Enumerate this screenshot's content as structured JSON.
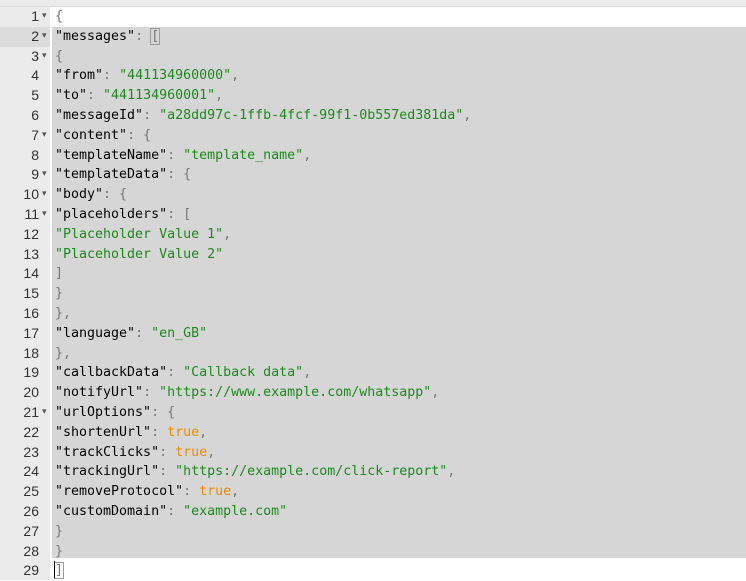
{
  "editor": {
    "active_line": 2,
    "fold_icon": "chevron-down-icon",
    "lines": [
      {
        "n": "1",
        "fold": true,
        "tokens": [
          {
            "t": "{",
            "c": "p"
          }
        ]
      },
      {
        "n": "2",
        "fold": true,
        "tokens": [
          {
            "t": "\"messages\"",
            "c": "k"
          },
          {
            "t": ": ",
            "c": "p"
          },
          {
            "t": "[",
            "c": "bm"
          }
        ]
      },
      {
        "n": "3",
        "fold": true,
        "tokens": [
          {
            "t": "{",
            "c": "p"
          }
        ]
      },
      {
        "n": "4",
        "fold": false,
        "tokens": [
          {
            "t": "\"from\"",
            "c": "k"
          },
          {
            "t": ": ",
            "c": "p"
          },
          {
            "t": "\"441134960000\"",
            "c": "s"
          },
          {
            "t": ",",
            "c": "p"
          }
        ]
      },
      {
        "n": "5",
        "fold": false,
        "tokens": [
          {
            "t": "\"to\"",
            "c": "k"
          },
          {
            "t": ": ",
            "c": "p"
          },
          {
            "t": "\"441134960001\"",
            "c": "s"
          },
          {
            "t": ",",
            "c": "p"
          }
        ]
      },
      {
        "n": "6",
        "fold": false,
        "tokens": [
          {
            "t": "\"messageId\"",
            "c": "k"
          },
          {
            "t": ": ",
            "c": "p"
          },
          {
            "t": "\"a28dd97c-1ffb-4fcf-99f1-0b557ed381da\"",
            "c": "s"
          },
          {
            "t": ",",
            "c": "p"
          }
        ]
      },
      {
        "n": "7",
        "fold": true,
        "tokens": [
          {
            "t": "\"content\"",
            "c": "k"
          },
          {
            "t": ": {",
            "c": "p"
          }
        ]
      },
      {
        "n": "8",
        "fold": false,
        "tokens": [
          {
            "t": "\"templateName\"",
            "c": "k"
          },
          {
            "t": ": ",
            "c": "p"
          },
          {
            "t": "\"template_name\"",
            "c": "s"
          },
          {
            "t": ",",
            "c": "p"
          }
        ]
      },
      {
        "n": "9",
        "fold": true,
        "tokens": [
          {
            "t": "\"templateData\"",
            "c": "k"
          },
          {
            "t": ": {",
            "c": "p"
          }
        ]
      },
      {
        "n": "10",
        "fold": true,
        "tokens": [
          {
            "t": "\"body\"",
            "c": "k"
          },
          {
            "t": ": {",
            "c": "p"
          }
        ]
      },
      {
        "n": "11",
        "fold": true,
        "tokens": [
          {
            "t": "\"placeholders\"",
            "c": "k"
          },
          {
            "t": ": [",
            "c": "p"
          }
        ]
      },
      {
        "n": "12",
        "fold": false,
        "tokens": [
          {
            "t": "\"Placeholder Value 1\"",
            "c": "s"
          },
          {
            "t": ",",
            "c": "p"
          }
        ]
      },
      {
        "n": "13",
        "fold": false,
        "tokens": [
          {
            "t": "\"Placeholder Value 2\"",
            "c": "s"
          }
        ]
      },
      {
        "n": "14",
        "fold": false,
        "tokens": [
          {
            "t": "]",
            "c": "p"
          }
        ]
      },
      {
        "n": "15",
        "fold": false,
        "tokens": [
          {
            "t": "}",
            "c": "p"
          }
        ]
      },
      {
        "n": "16",
        "fold": false,
        "tokens": [
          {
            "t": "},",
            "c": "p"
          }
        ]
      },
      {
        "n": "17",
        "fold": false,
        "tokens": [
          {
            "t": "\"language\"",
            "c": "k"
          },
          {
            "t": ": ",
            "c": "p"
          },
          {
            "t": "\"en_GB\"",
            "c": "s"
          }
        ]
      },
      {
        "n": "18",
        "fold": false,
        "tokens": [
          {
            "t": "},",
            "c": "p"
          }
        ]
      },
      {
        "n": "19",
        "fold": false,
        "tokens": [
          {
            "t": "\"callbackData\"",
            "c": "k"
          },
          {
            "t": ": ",
            "c": "p"
          },
          {
            "t": "\"Callback data\"",
            "c": "s"
          },
          {
            "t": ",",
            "c": "p"
          }
        ]
      },
      {
        "n": "20",
        "fold": false,
        "tokens": [
          {
            "t": "\"notifyUrl\"",
            "c": "k"
          },
          {
            "t": ": ",
            "c": "p"
          },
          {
            "t": "\"https://www.example.com/whatsapp\"",
            "c": "s"
          },
          {
            "t": ",",
            "c": "p"
          }
        ]
      },
      {
        "n": "21",
        "fold": true,
        "tokens": [
          {
            "t": "\"urlOptions\"",
            "c": "k"
          },
          {
            "t": ": {",
            "c": "p"
          }
        ]
      },
      {
        "n": "22",
        "fold": false,
        "tokens": [
          {
            "t": "\"shortenUrl\"",
            "c": "k"
          },
          {
            "t": ": ",
            "c": "p"
          },
          {
            "t": "true",
            "c": "b"
          },
          {
            "t": ",",
            "c": "p"
          }
        ]
      },
      {
        "n": "23",
        "fold": false,
        "tokens": [
          {
            "t": "\"trackClicks\"",
            "c": "k"
          },
          {
            "t": ": ",
            "c": "p"
          },
          {
            "t": "true",
            "c": "b"
          },
          {
            "t": ",",
            "c": "p"
          }
        ]
      },
      {
        "n": "24",
        "fold": false,
        "tokens": [
          {
            "t": "\"trackingUrl\"",
            "c": "k"
          },
          {
            "t": ": ",
            "c": "p"
          },
          {
            "t": "\"https://example.com/click-report\"",
            "c": "s"
          },
          {
            "t": ",",
            "c": "p"
          }
        ]
      },
      {
        "n": "25",
        "fold": false,
        "tokens": [
          {
            "t": "\"removeProtocol\"",
            "c": "k"
          },
          {
            "t": ": ",
            "c": "p"
          },
          {
            "t": "true",
            "c": "b"
          },
          {
            "t": ",",
            "c": "p"
          }
        ]
      },
      {
        "n": "26",
        "fold": false,
        "tokens": [
          {
            "t": "\"customDomain\"",
            "c": "k"
          },
          {
            "t": ": ",
            "c": "p"
          },
          {
            "t": "\"example.com\"",
            "c": "s"
          }
        ]
      },
      {
        "n": "27",
        "fold": false,
        "tokens": [
          {
            "t": "}",
            "c": "p"
          }
        ]
      },
      {
        "n": "28",
        "fold": false,
        "tokens": [
          {
            "t": "}",
            "c": "p"
          }
        ]
      },
      {
        "n": "29",
        "fold": false,
        "tokens": [
          {
            "t": "]",
            "c": "bm"
          }
        ]
      }
    ]
  },
  "colors": {
    "key": "#000000",
    "string": "#1a8a1a",
    "boolean": "#f08c00",
    "punctuation": "#777777",
    "selection": "#d6d6d6",
    "gutter": "#ebebeb"
  }
}
